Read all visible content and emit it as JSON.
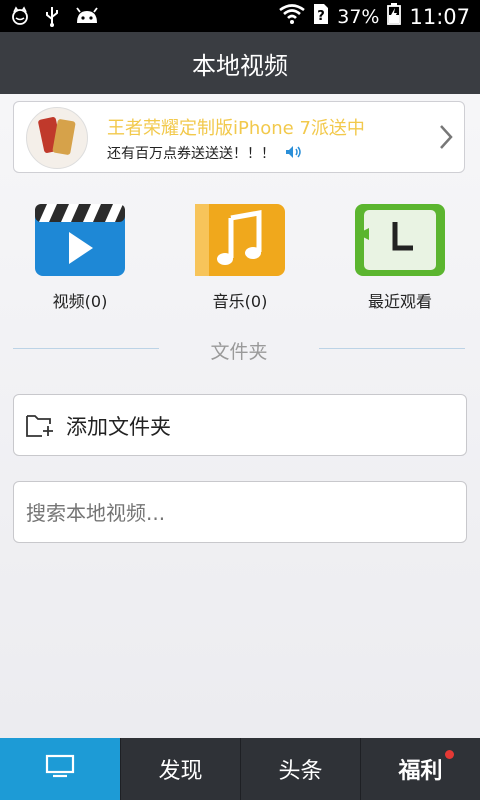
{
  "status_bar": {
    "battery": "37%",
    "time": "11:07"
  },
  "header": {
    "title": "本地视频"
  },
  "banner": {
    "title": "王者荣耀定制版iPhone 7派送中",
    "subtitle": "还有百万点券送送送！！！"
  },
  "categories": [
    {
      "label": "视频(0)",
      "color": "#1e88d6"
    },
    {
      "label": "音乐(0)",
      "color": "#f0a81c"
    },
    {
      "label": "最近观看",
      "color": "#5bb52f"
    }
  ],
  "folder_section": {
    "title": "文件夹",
    "add_label": "添加文件夹"
  },
  "search": {
    "placeholder": "搜索本地视频..."
  },
  "tabs": {
    "discover": "发现",
    "headlines": "头条",
    "welfare": "福利"
  }
}
